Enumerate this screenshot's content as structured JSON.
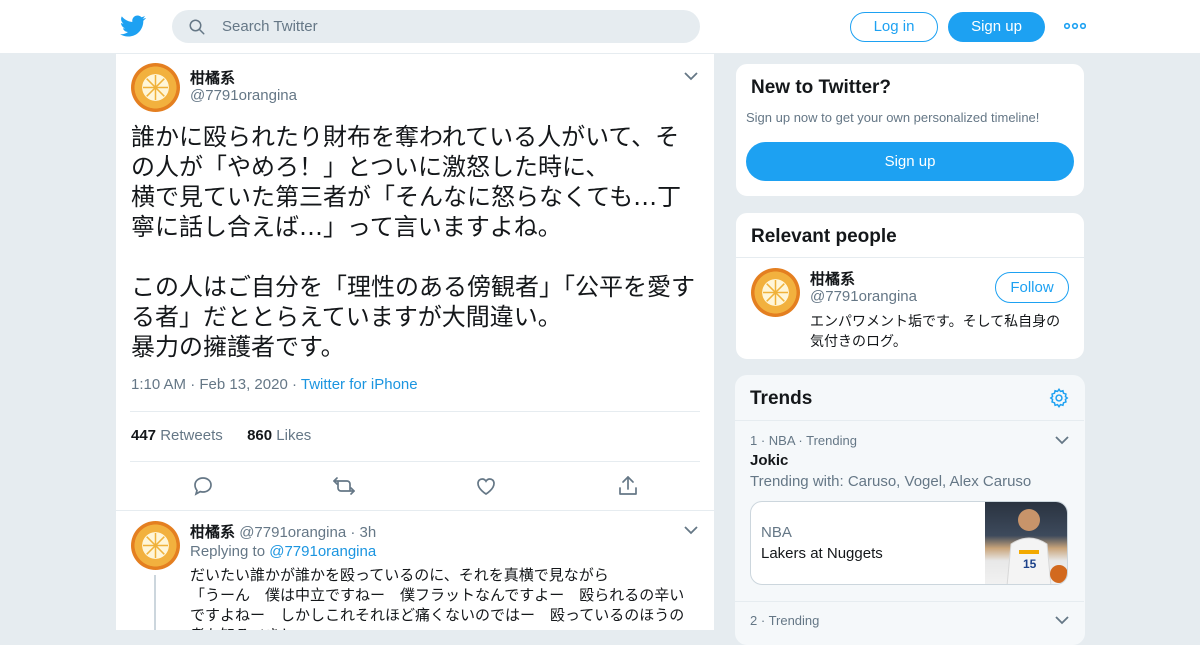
{
  "header": {
    "search_placeholder": "Search Twitter",
    "login_label": "Log in",
    "signup_label": "Sign up"
  },
  "tweet": {
    "author_name": "柑橘系",
    "author_handle": "@7791orangina",
    "text": "誰かに殴られたり財布を奪われている人がいて、その人が「やめろ！」とついに激怒した時に、\n横で見ていた第三者が「そんなに怒らなくても…丁寧に話し合えば…」って言いますよね。\n\nこの人はご自分を「理性のある傍観者」「公平を愛する者」だととらえていますが大間違い。\n暴力の擁護者です。",
    "time": "1:10 AM",
    "date": "Feb 13, 2020",
    "source": "Twitter for iPhone",
    "retweets": "447",
    "retweets_label": "Retweets",
    "likes": "860",
    "likes_label": "Likes"
  },
  "reply": {
    "author_name": "柑橘系",
    "author_handle": "@7791orangina",
    "age": "3h",
    "replying_label": "Replying to",
    "replying_to": "@7791orangina",
    "text": "だいたい誰かが誰かを殴っているのに、それを真横で見ながら\n「うーん　僕は中立ですねー　僕フラットなんですよー　殴られるの辛いですよねー　しかしこれそれほど痛くないのではー　殴っているのほうの考も知るべきと"
  },
  "sidebar": {
    "new_title": "New to Twitter?",
    "new_subtitle": "Sign up now to get your own personalized timeline!",
    "new_signup_label": "Sign up",
    "relevant_title": "Relevant people",
    "person": {
      "name": "柑橘系",
      "handle": "@7791orangina",
      "follow_label": "Follow",
      "bio": "エンパワメント垢です。そして私自身の気付きのログ。"
    },
    "trends_title": "Trends",
    "trends": [
      {
        "rank": "1",
        "category": "NBA",
        "status": "Trending",
        "name": "Jokic",
        "with": "Trending with: Caruso, Vogel, Alex Caruso",
        "news_category": "NBA",
        "news_title": "Lakers at Nuggets"
      },
      {
        "rank": "2",
        "status": "Trending"
      }
    ]
  },
  "colors": {
    "accent": "#1da1f2",
    "link": "#1b95e0",
    "background": "#e6ecf0",
    "muted": "#657786"
  }
}
